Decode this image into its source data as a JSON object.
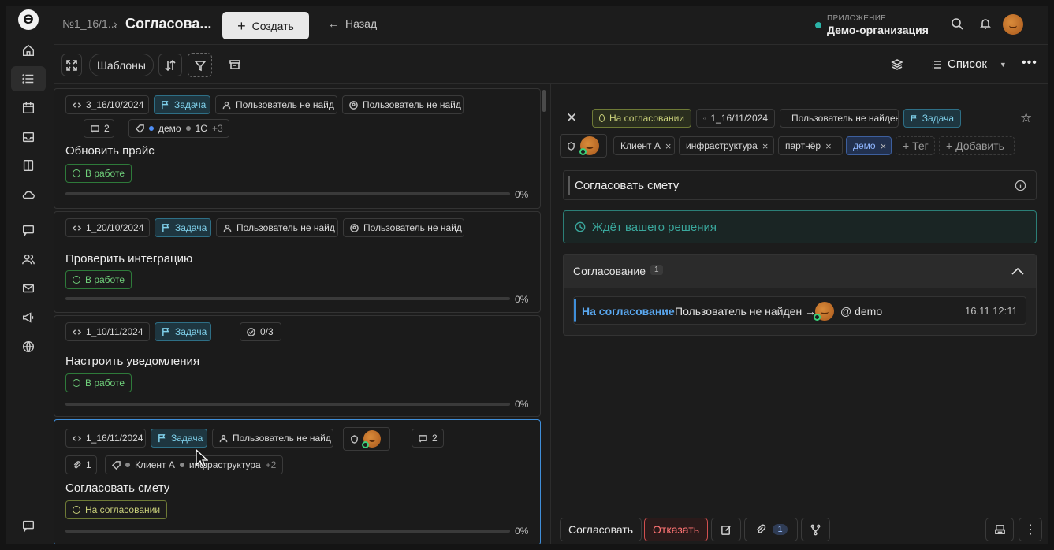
{
  "header": {
    "breadcrumb": "№1_16/1...",
    "breadcrumb_sep": "›",
    "title": "Согласова...",
    "create_label": "Создать",
    "back_label": "Назад",
    "app_caption": "ПРИЛОЖЕНИЕ",
    "app_name": "Демо-организация",
    "app_status_color": "#2bb3a7"
  },
  "toolbar": {
    "templates_label": "Шаблоны",
    "view_label": "Список"
  },
  "cards": [
    {
      "id": "3_16/10/2024",
      "type": "Задача",
      "assignee": "Пользователь не найд",
      "author": "Пользователь не найд",
      "comments": "2",
      "tags": [
        "демо",
        "1С"
      ],
      "tags_more": "+3",
      "title": "Обновить прайс",
      "status": "В работе",
      "percent": "0%"
    },
    {
      "id": "1_20/10/2024",
      "type": "Задача",
      "assignee": "Пользователь не найд",
      "author": "Пользователь не найд",
      "title": "Проверить интеграцию",
      "status": "В работе",
      "percent": "0%"
    },
    {
      "id": "1_10/11/2024",
      "type": "Задача",
      "checklist": "0/3",
      "title": "Настроить уведомления",
      "status": "В работе",
      "percent": "0%"
    },
    {
      "id": "1_16/11/2024",
      "type": "Задача",
      "assignee": "Пользователь не найд",
      "comments": "2",
      "attachments": "1",
      "tags": [
        "Клиент А",
        "инфраструктура"
      ],
      "tags_more": "+2",
      "title": "Согласовать смету",
      "status": "На согласовании",
      "percent": "0%"
    }
  ],
  "detail": {
    "status": "На согласовании",
    "id": "1_16/11/2024",
    "assignee": "Пользователь не найден",
    "type": "Задача",
    "tags": [
      "Клиент А",
      "инфраструктура",
      "партнёр",
      "демо"
    ],
    "add_tag_label": "+ Тег",
    "add_label": "+ Добавить",
    "title": "Согласовать смету",
    "waiting_text": "Ждёт вашего решения",
    "approval": {
      "title": "Согласование",
      "count": "1",
      "row_status": "На согласование",
      "row_user": "Пользователь не найден →",
      "row_target": "@ demo",
      "row_time": "16.11 12:11"
    },
    "footer": {
      "approve_label": "Согласовать",
      "reject_label": "Отказать",
      "attachments_count": "1"
    }
  },
  "colors": {
    "accent_blue": "#3f8ed9",
    "task_cyan": "#7fd0ea",
    "status_green": "#6fcf7a",
    "status_pending": "#c9d07a",
    "reject_red": "#ff7474",
    "waiting_teal": "#3aa79c"
  }
}
